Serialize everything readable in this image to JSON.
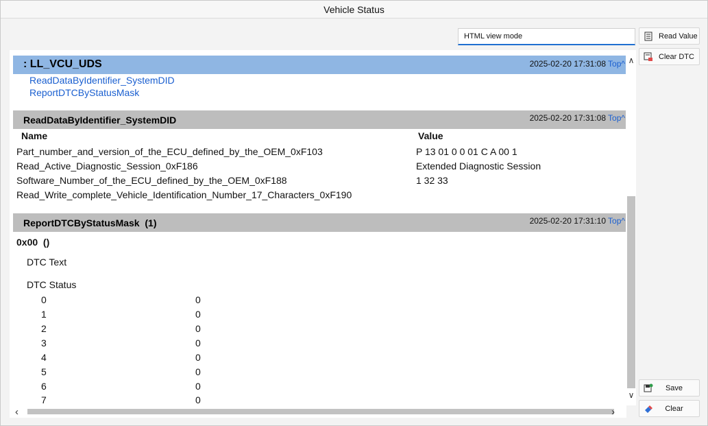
{
  "window": {
    "title": "Vehicle Status"
  },
  "toolbar": {
    "mode_value": "HTML view mode",
    "read_value_label": "Read Value",
    "clear_dtc_label": "Clear DTC",
    "save_label": "Save",
    "clear_label": "Clear"
  },
  "icons": {
    "read_value": "document-list-icon",
    "clear_dtc": "clear-dtc-icon",
    "save": "save-icon",
    "clear": "eraser-icon"
  },
  "colors": {
    "blue_header": "#8fb6e3",
    "gray_header": "#bdbdbd",
    "link": "#1a5fd0",
    "accent": "#1f6fd1"
  },
  "sections": {
    "root": {
      "title": ": LL_VCU_UDS",
      "timestamp": "2025-02-20 17:31:08",
      "top_link": "Top^",
      "links": [
        "ReadDataByIdentifier_SystemDID",
        "ReportDTCByStatusMask"
      ]
    },
    "read_data": {
      "title": "ReadDataByIdentifier_SystemDID",
      "timestamp": "2025-02-20 17:31:08",
      "top_link": "Top^",
      "col_name": "Name",
      "col_value": "Value",
      "rows": [
        {
          "name": "Part_number_and_version_of_the_ECU_defined_by_the_OEM_0xF103",
          "value": "P 13 01 0 0 01 C A 00 1"
        },
        {
          "name": "Read_Active_Diagnostic_Session_0xF186",
          "value": "Extended Diagnostic Session"
        },
        {
          "name": "Software_Number_of_the_ECU_defined_by_the_OEM_0xF188",
          "value": "1 32 33"
        },
        {
          "name": "Read_Write_complete_Vehicle_Identification_Number_17_Characters_0xF190",
          "value": ""
        }
      ]
    },
    "dtc": {
      "title": "ReportDTCByStatusMask  (1)",
      "timestamp": "2025-02-20 17:31:10",
      "top_link": "Top^",
      "code": "0x00  ()",
      "dtc_text_label": "DTC Text",
      "dtc_status_label": "DTC Status",
      "status_rows": [
        {
          "bit": "0",
          "value": "0"
        },
        {
          "bit": "1",
          "value": "0"
        },
        {
          "bit": "2",
          "value": "0"
        },
        {
          "bit": "3",
          "value": "0"
        },
        {
          "bit": "4",
          "value": "0"
        },
        {
          "bit": "5",
          "value": "0"
        },
        {
          "bit": "6",
          "value": "0"
        },
        {
          "bit": "7",
          "value": "0"
        }
      ]
    }
  }
}
